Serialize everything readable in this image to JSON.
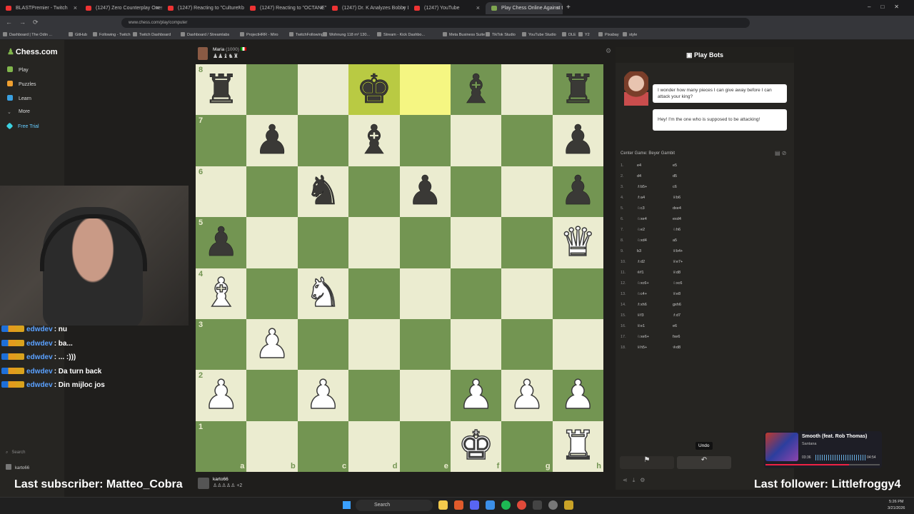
{
  "browser": {
    "tabs": [
      {
        "label": "BLASTPremier - Twitch"
      },
      {
        "label": "(1247) Zero Counterplay Onesl"
      },
      {
        "label": "(1247) Reacting to \"Culture\" by"
      },
      {
        "label": "(1247) Reacting to \"OCTANE\" b"
      },
      {
        "label": "(1247) Dr. K Analyzes Bobby Le"
      },
      {
        "label": "(1247) YouTube"
      },
      {
        "label": "Play Chess Online Against t"
      }
    ],
    "url": "www.chess.com/play/computer",
    "bookmarks": [
      "Dashboard | The Odin ...",
      "GitHub",
      "Following - Twitch",
      "Twitch Dashboard",
      "Dashboard / Streamlabs",
      "ProjectHRR - Miro",
      "TwitchFollowing",
      "Wohnung 118 m² 130...",
      "Stream - Kick Dashbo...",
      "Meta Business Suite",
      "TikTok Studio",
      "YouTube Studio",
      "DLE",
      "Y2",
      "Pixabay",
      "style"
    ]
  },
  "sidebar": {
    "logo": "Chess.com",
    "items": [
      {
        "label": "Play"
      },
      {
        "label": "Puzzles"
      },
      {
        "label": "Learn"
      },
      {
        "label": "More"
      },
      {
        "label": "Free Trial"
      }
    ],
    "search_label": "Search",
    "user": "karto66"
  },
  "chat": [
    {
      "user": "edwdev",
      "text": ": nu"
    },
    {
      "user": "edwdev",
      "text": ": ba..."
    },
    {
      "user": "edwdev",
      "text": ": ... :)))"
    },
    {
      "user": "edwdev",
      "text": ": Da turn back"
    },
    {
      "user": "edwdev",
      "text": ": Din mijloc jos"
    }
  ],
  "opponent": {
    "name": "Maria",
    "rating": "(1000)"
  },
  "player": {
    "name": "karto66",
    "extra": "+2"
  },
  "board": {
    "rows": [
      [
        "bR",
        "",
        "",
        "bK",
        "",
        "bB",
        "",
        "bR"
      ],
      [
        "",
        "bP",
        "",
        "bB",
        "",
        "",
        "",
        "bP"
      ],
      [
        "",
        "",
        "bN",
        "",
        "bP",
        "",
        "",
        "bP"
      ],
      [
        "bP",
        "",
        "",
        "",
        "",
        "",
        "",
        "wQ"
      ],
      [
        "wB",
        "",
        "wN",
        "",
        "",
        "",
        "",
        ""
      ],
      [
        "",
        "wP",
        "",
        "",
        "",
        "",
        "",
        ""
      ],
      [
        "wP",
        "",
        "wP",
        "",
        "",
        "wP",
        "wP",
        "wP"
      ],
      [
        "",
        "",
        "",
        "",
        "",
        "wK",
        "",
        "wR"
      ]
    ],
    "highlights": [
      "d8",
      "e8"
    ],
    "ranks": [
      "8",
      "7",
      "6",
      "5",
      "4",
      "3",
      "2",
      "1"
    ],
    "files": [
      "a",
      "b",
      "c",
      "d",
      "e",
      "f",
      "g",
      "h"
    ]
  },
  "panel": {
    "title": "Play Bots",
    "bubbles": [
      "I wonder how many pieces I can give away before I can attack your king?",
      "Hey! I'm the one who is supposed to be attacking!"
    ],
    "opening": "Center Game: Beyer Gambit",
    "moves": [
      {
        "n": "1.",
        "w": "e4",
        "b": "e5"
      },
      {
        "n": "2.",
        "w": "d4",
        "b": "d5"
      },
      {
        "n": "3.",
        "w": "♗b5+",
        "b": "c6"
      },
      {
        "n": "4.",
        "w": "♗a4",
        "b": "♕b6"
      },
      {
        "n": "5.",
        "w": "♘c3",
        "b": "dxe4"
      },
      {
        "n": "6.",
        "w": "♘xe4",
        "b": "exd4"
      },
      {
        "n": "7.",
        "w": "♘e2",
        "b": "♘h6"
      },
      {
        "n": "8.",
        "w": "♘xd4",
        "b": "a5"
      },
      {
        "n": "9.",
        "w": "b3",
        "b": "♕b4+"
      },
      {
        "n": "10.",
        "w": "♗d2",
        "b": "♕e7+"
      },
      {
        "n": "11.",
        "w": "♔f1",
        "b": "♕d8"
      },
      {
        "n": "12.",
        "w": "♘xc6+",
        "b": "♘xc6"
      },
      {
        "n": "13.",
        "w": "♘c4+",
        "b": "♕e8"
      },
      {
        "n": "14.",
        "w": "♗xh6",
        "b": "gxh6"
      },
      {
        "n": "15.",
        "w": "♕f3",
        "b": "♗d7"
      },
      {
        "n": "16.",
        "w": "♕e1",
        "b": "e6"
      },
      {
        "n": "17.",
        "w": "♘xe6+",
        "b": "fxe6"
      },
      {
        "n": "18.",
        "w": "♕h5+",
        "b": "♔d8"
      }
    ],
    "undo_tooltip": "Undo"
  },
  "music": {
    "title": "Smooth (feat. Rob Thomas)",
    "artist": "Santana",
    "elapsed": "03:36",
    "total": "04:54"
  },
  "overlay": {
    "subscriber": "Last subscriber: Matteo_Cobra",
    "follower": "Last follower: Littlefroggy4"
  },
  "taskbar": {
    "search": "Search",
    "time": "5:26 PM",
    "date": "3/21/2026"
  }
}
